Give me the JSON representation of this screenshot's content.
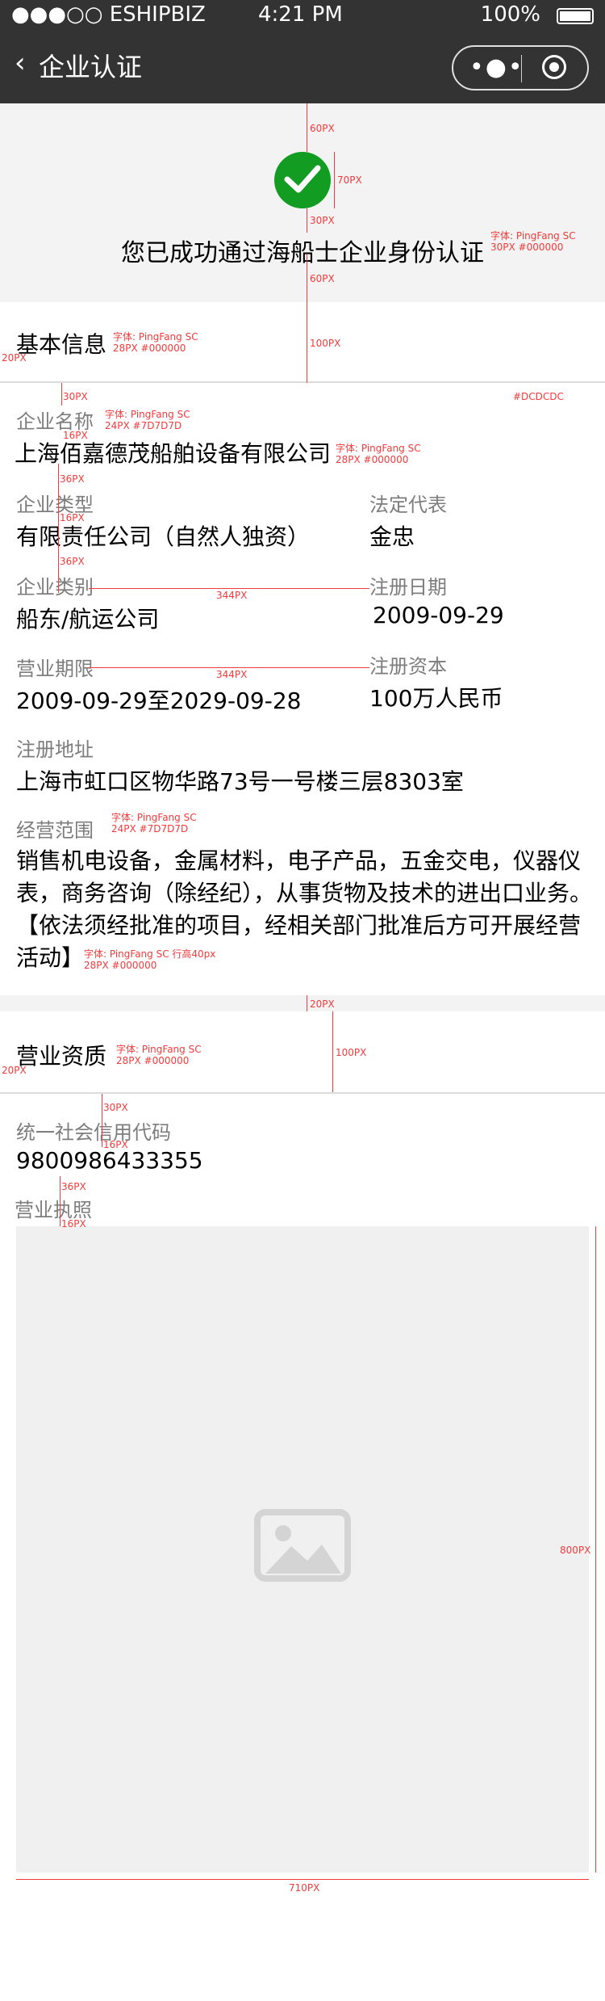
{
  "status_bar": {
    "carrier": "●●●○○ ESHIPBIZ",
    "time": "4:21 PM",
    "battery": "100%"
  },
  "navbar": {
    "back_icon": "‹",
    "title": "企业认证"
  },
  "hero": {
    "message": "您已成功通过海船士企业身份认证"
  },
  "basic_info": {
    "title": "基本信息",
    "company_name_label": "企业名称",
    "company_name": "上海佰嘉德茂船舶设备有限公司",
    "company_type_label": "企业类型",
    "company_type": "有限责任公司（自然人独资）",
    "legal_rep_label": "法定代表",
    "legal_rep": "金忠",
    "category_label": "企业类别",
    "category": "船东/航运公司",
    "reg_date_label": "注册日期",
    "reg_date": "2009-09-29",
    "term_label": "营业期限",
    "term": "2009-09-29至2029-09-28",
    "capital_label": "注册资本",
    "capital": "100万人民币",
    "address_label": "注册地址",
    "address": "上海市虹口区物华路73号一号楼三层8303室",
    "scope_label": "经营范围",
    "scope": "销售机电设备，金属材料，电子产品，五金交电，仪器仪表，商务咨询（除经纪），从事货物及技术的进出口业务。【依法须经批准的项目，经相关部门批准后方可开展经营活动】"
  },
  "qualification": {
    "title": "营业资质",
    "credit_code_label": "统一社会信用代码",
    "credit_code": "9800986433355",
    "license_label": "营业执照"
  },
  "annotations": {
    "a60": "60PX",
    "a70": "70PX",
    "a30": "30PX",
    "a60b": "60PX",
    "font_hero": "字体: PingFang SC",
    "font_hero_size": "30PX #000000",
    "font_title": "字体: PingFang SC",
    "font_title_size": "28PX #000000",
    "a20": "20PX",
    "a100": "100PX",
    "divider_color": "#DCDCDC",
    "a30b": "30PX",
    "font_label": "字体: PingFang SC",
    "font_label_size": "24PX #7D7D7D",
    "a16": "16PX",
    "font_value": "字体: PingFang SC",
    "font_value_size": "28PX #000000",
    "a36": "36PX",
    "a16b": "16PX",
    "a36b": "36PX",
    "a344": "344PX",
    "a344b": "344PX",
    "font_label2": "字体: PingFang SC",
    "font_label2_size": "24PX #7D7D7D",
    "font_scope": "字体: PingFang SC    行高40px",
    "font_scope_size": "28PX #000000",
    "a20c": "20PX",
    "font_title2": "字体: PingFang SC",
    "font_title2_size": "28PX #000000",
    "a20d": "20PX",
    "a100b": "100PX",
    "a30c": "30PX",
    "a16c": "16PX",
    "a36c": "36PX",
    "a16d": "16PX",
    "a800": "800PX",
    "a710": "710PX"
  }
}
